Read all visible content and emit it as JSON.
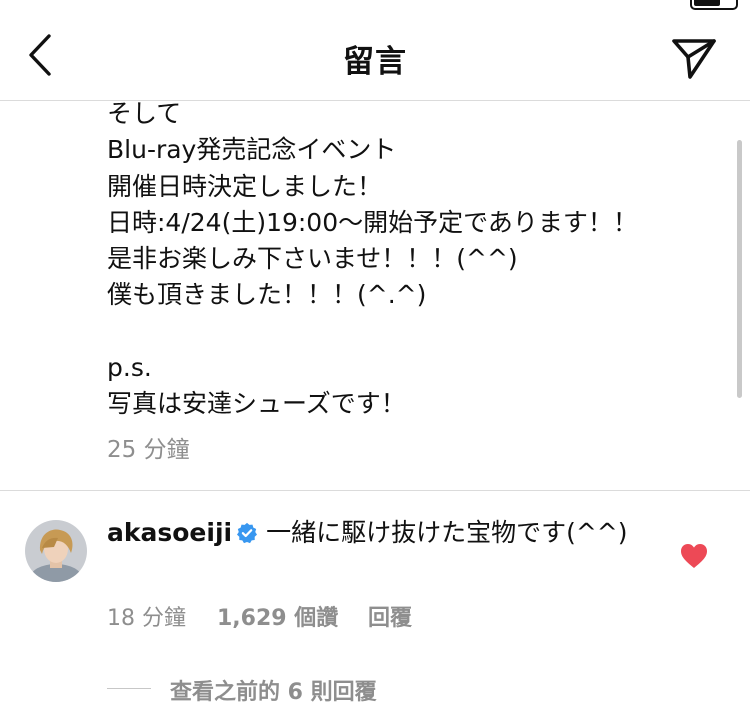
{
  "colors": {
    "accent_verified": "#3897f0",
    "heart": "#ed4956",
    "secondary_text": "#8e8e8e",
    "divider": "#dbdbdb"
  },
  "icons": {
    "back": "chevron-left-icon",
    "share": "paper-plane-icon",
    "verified": "verified-badge-icon",
    "like": "heart-filled-icon"
  },
  "status_bar": {
    "carrier": "",
    "time": "",
    "battery": ""
  },
  "header": {
    "title": "留言"
  },
  "caption": {
    "lines": [
      "そして",
      "Blu-ray発売記念イベント",
      "開催日時決定しました！",
      "日時:4/24(土)19:00～開始予定であります！！",
      "是非お楽しみ下さいませ！！！(^^)",
      "僕も頂きました！！！(^.^)",
      "",
      "p.s.",
      "写真は安達シューズです！"
    ],
    "time_ago": "25 分鐘"
  },
  "comment": {
    "username": "akasoeiji",
    "text": "一緒に駆け抜けた宝物です(^^)",
    "time_ago": "18 分鐘",
    "likes": "1,629 個讚",
    "reply_label": "回覆",
    "liked": true,
    "view_replies_label": "查看之前的 6 則回覆"
  }
}
